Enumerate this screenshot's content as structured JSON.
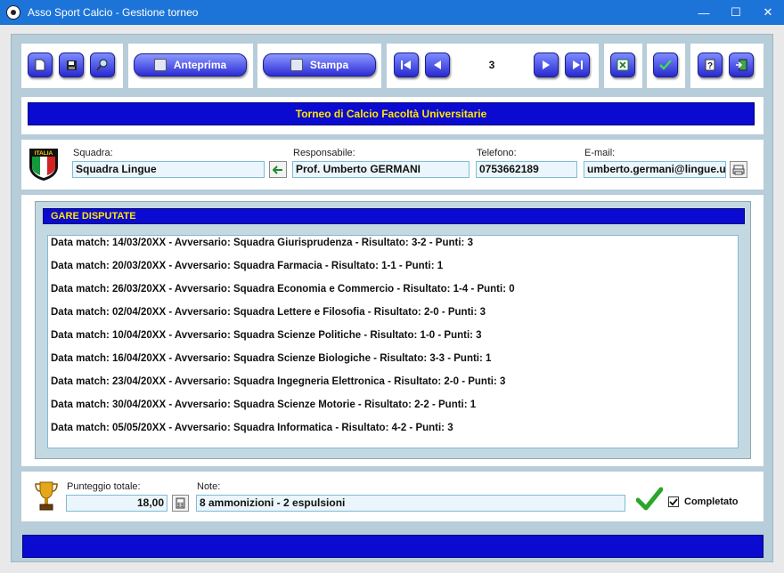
{
  "window": {
    "title": "Asso Sport Calcio - Gestione torneo",
    "controls": [
      "—",
      "☐",
      "✕"
    ]
  },
  "toolbar": {
    "preview_label": "Anteprima",
    "print_label": "Stampa",
    "record_number": "3"
  },
  "header": {
    "banner": "Torneo di Calcio Facoltà Universitarie"
  },
  "team": {
    "logo_text": "ITALIA",
    "squadra_label": "Squadra:",
    "squadra_value": "Squadra Lingue",
    "responsabile_label": "Responsabile:",
    "responsabile_value": "Prof. Umberto GERMANI",
    "telefono_label": "Telefono:",
    "telefono_value": "0753662189",
    "email_label": "E-mail:",
    "email_value": "umberto.germani@lingue.u"
  },
  "matches": {
    "header": "GARE DISPUTATE",
    "rows": [
      "Data match: 14/03/20XX - Avversario: Squadra Giurisprudenza - Risultato: 3-2 - Punti: 3",
      "Data match: 20/03/20XX - Avversario: Squadra Farmacia - Risultato: 1-1 - Punti: 1",
      "Data match: 26/03/20XX - Avversario: Squadra Economia e Commercio - Risultato: 1-4 - Punti: 0",
      "Data match: 02/04/20XX - Avversario: Squadra Lettere e Filosofia - Risultato: 2-0 - Punti: 3",
      "Data match: 10/04/20XX - Avversario: Squadra Scienze Politiche - Risultato: 1-0 - Punti: 3",
      "Data match: 16/04/20XX - Avversario: Squadra Scienze Biologiche - Risultato: 3-3 - Punti: 1",
      "Data match: 23/04/20XX - Avversario: Squadra Ingegneria Elettronica - Risultato: 2-0 - Punti: 3",
      "Data match: 30/04/20XX - Avversario: Squadra Scienze Motorie - Risultato: 2-2 - Punti: 1",
      "Data match: 05/05/20XX - Avversario: Squadra Informatica - Risultato: 4-2 - Punti: 3"
    ]
  },
  "summary": {
    "punteggio_label": "Punteggio totale:",
    "punteggio_value": "18,00",
    "note_label": "Note:",
    "note_value": "8 ammonizioni - 2 espulsioni",
    "completato_label": "Completato",
    "completato_checked": true
  },
  "colors": {
    "accent_blue": "#0a0ad0",
    "banner_text": "#ffe600",
    "titlebar": "#1d74d8"
  }
}
